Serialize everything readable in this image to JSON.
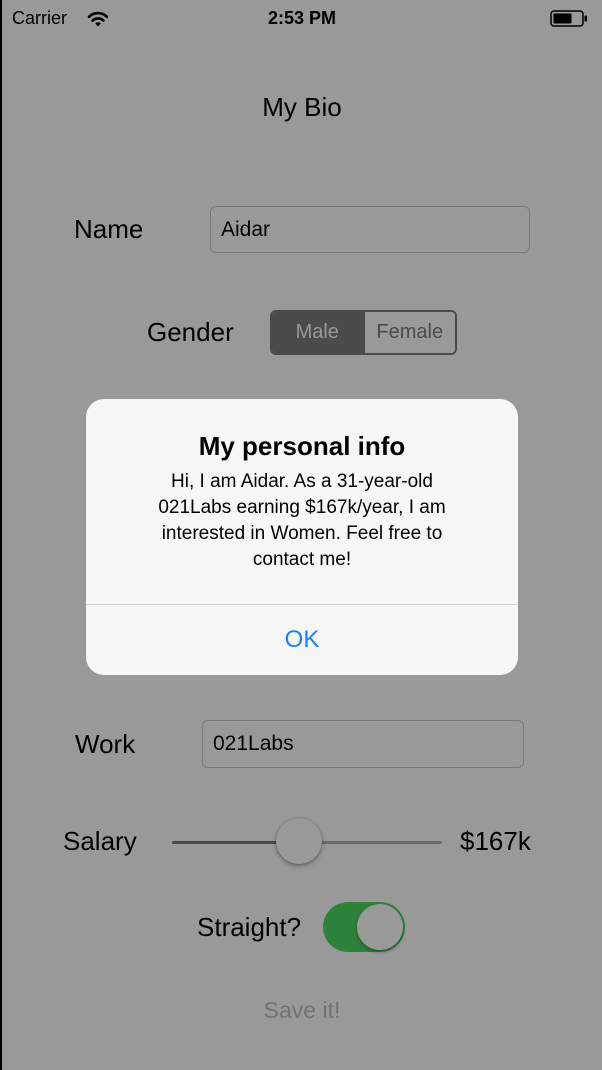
{
  "status_bar": {
    "carrier": "Carrier",
    "time": "2:53 PM"
  },
  "title": "My Bio",
  "form": {
    "name_label": "Name",
    "name_value": "Aidar",
    "gender_label": "Gender",
    "gender_options": [
      "Male",
      "Female"
    ],
    "gender_selected": "Male",
    "work_label": "Work",
    "work_value": "021Labs",
    "salary_label": "Salary",
    "salary_value": "$167k",
    "salary_slider_fraction": 0.47,
    "straight_label": "Straight?",
    "straight_on": true,
    "save_label": "Save it!"
  },
  "alert": {
    "title": "My personal info",
    "message": "Hi, I am Aidar. As a 31-year-old 021Labs earning $167k/year, I am interested in Women. Feel free to contact me!",
    "ok_label": "OK"
  },
  "colors": {
    "toggle_on": "#4cd964",
    "alert_button": "#1a82f7",
    "segment_selected": "#7d7d7d"
  },
  "icons": [
    "wifi-icon",
    "battery-icon"
  ]
}
